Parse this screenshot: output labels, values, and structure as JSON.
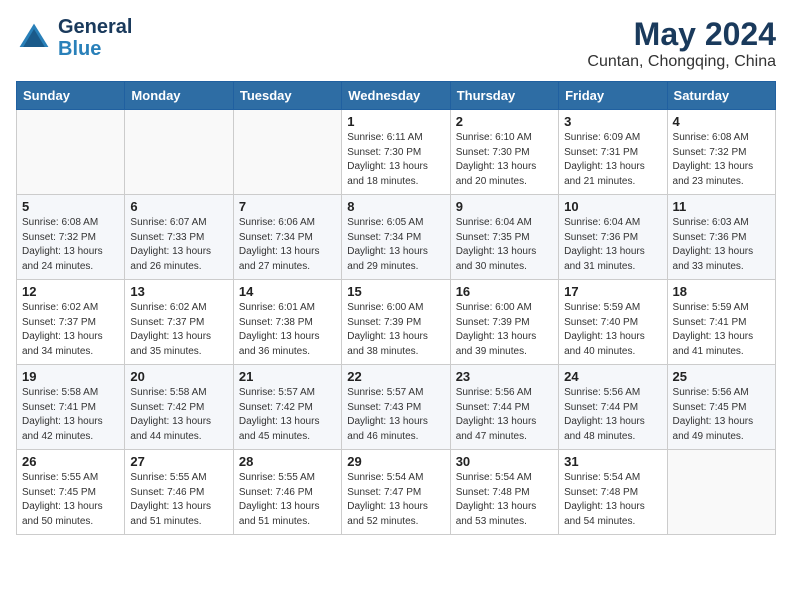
{
  "app": {
    "name": "GeneralBlue",
    "logo_line1": "General",
    "logo_line2": "Blue"
  },
  "title": "May 2024",
  "subtitle": "Cuntan, Chongqing, China",
  "weekdays": [
    "Sunday",
    "Monday",
    "Tuesday",
    "Wednesday",
    "Thursday",
    "Friday",
    "Saturday"
  ],
  "weeks": [
    [
      {
        "day": "",
        "info": ""
      },
      {
        "day": "",
        "info": ""
      },
      {
        "day": "",
        "info": ""
      },
      {
        "day": "1",
        "info": "Sunrise: 6:11 AM\nSunset: 7:30 PM\nDaylight: 13 hours\nand 18 minutes."
      },
      {
        "day": "2",
        "info": "Sunrise: 6:10 AM\nSunset: 7:30 PM\nDaylight: 13 hours\nand 20 minutes."
      },
      {
        "day": "3",
        "info": "Sunrise: 6:09 AM\nSunset: 7:31 PM\nDaylight: 13 hours\nand 21 minutes."
      },
      {
        "day": "4",
        "info": "Sunrise: 6:08 AM\nSunset: 7:32 PM\nDaylight: 13 hours\nand 23 minutes."
      }
    ],
    [
      {
        "day": "5",
        "info": "Sunrise: 6:08 AM\nSunset: 7:32 PM\nDaylight: 13 hours\nand 24 minutes."
      },
      {
        "day": "6",
        "info": "Sunrise: 6:07 AM\nSunset: 7:33 PM\nDaylight: 13 hours\nand 26 minutes."
      },
      {
        "day": "7",
        "info": "Sunrise: 6:06 AM\nSunset: 7:34 PM\nDaylight: 13 hours\nand 27 minutes."
      },
      {
        "day": "8",
        "info": "Sunrise: 6:05 AM\nSunset: 7:34 PM\nDaylight: 13 hours\nand 29 minutes."
      },
      {
        "day": "9",
        "info": "Sunrise: 6:04 AM\nSunset: 7:35 PM\nDaylight: 13 hours\nand 30 minutes."
      },
      {
        "day": "10",
        "info": "Sunrise: 6:04 AM\nSunset: 7:36 PM\nDaylight: 13 hours\nand 31 minutes."
      },
      {
        "day": "11",
        "info": "Sunrise: 6:03 AM\nSunset: 7:36 PM\nDaylight: 13 hours\nand 33 minutes."
      }
    ],
    [
      {
        "day": "12",
        "info": "Sunrise: 6:02 AM\nSunset: 7:37 PM\nDaylight: 13 hours\nand 34 minutes."
      },
      {
        "day": "13",
        "info": "Sunrise: 6:02 AM\nSunset: 7:37 PM\nDaylight: 13 hours\nand 35 minutes."
      },
      {
        "day": "14",
        "info": "Sunrise: 6:01 AM\nSunset: 7:38 PM\nDaylight: 13 hours\nand 36 minutes."
      },
      {
        "day": "15",
        "info": "Sunrise: 6:00 AM\nSunset: 7:39 PM\nDaylight: 13 hours\nand 38 minutes."
      },
      {
        "day": "16",
        "info": "Sunrise: 6:00 AM\nSunset: 7:39 PM\nDaylight: 13 hours\nand 39 minutes."
      },
      {
        "day": "17",
        "info": "Sunrise: 5:59 AM\nSunset: 7:40 PM\nDaylight: 13 hours\nand 40 minutes."
      },
      {
        "day": "18",
        "info": "Sunrise: 5:59 AM\nSunset: 7:41 PM\nDaylight: 13 hours\nand 41 minutes."
      }
    ],
    [
      {
        "day": "19",
        "info": "Sunrise: 5:58 AM\nSunset: 7:41 PM\nDaylight: 13 hours\nand 42 minutes."
      },
      {
        "day": "20",
        "info": "Sunrise: 5:58 AM\nSunset: 7:42 PM\nDaylight: 13 hours\nand 44 minutes."
      },
      {
        "day": "21",
        "info": "Sunrise: 5:57 AM\nSunset: 7:42 PM\nDaylight: 13 hours\nand 45 minutes."
      },
      {
        "day": "22",
        "info": "Sunrise: 5:57 AM\nSunset: 7:43 PM\nDaylight: 13 hours\nand 46 minutes."
      },
      {
        "day": "23",
        "info": "Sunrise: 5:56 AM\nSunset: 7:44 PM\nDaylight: 13 hours\nand 47 minutes."
      },
      {
        "day": "24",
        "info": "Sunrise: 5:56 AM\nSunset: 7:44 PM\nDaylight: 13 hours\nand 48 minutes."
      },
      {
        "day": "25",
        "info": "Sunrise: 5:56 AM\nSunset: 7:45 PM\nDaylight: 13 hours\nand 49 minutes."
      }
    ],
    [
      {
        "day": "26",
        "info": "Sunrise: 5:55 AM\nSunset: 7:45 PM\nDaylight: 13 hours\nand 50 minutes."
      },
      {
        "day": "27",
        "info": "Sunrise: 5:55 AM\nSunset: 7:46 PM\nDaylight: 13 hours\nand 51 minutes."
      },
      {
        "day": "28",
        "info": "Sunrise: 5:55 AM\nSunset: 7:46 PM\nDaylight: 13 hours\nand 51 minutes."
      },
      {
        "day": "29",
        "info": "Sunrise: 5:54 AM\nSunset: 7:47 PM\nDaylight: 13 hours\nand 52 minutes."
      },
      {
        "day": "30",
        "info": "Sunrise: 5:54 AM\nSunset: 7:48 PM\nDaylight: 13 hours\nand 53 minutes."
      },
      {
        "day": "31",
        "info": "Sunrise: 5:54 AM\nSunset: 7:48 PM\nDaylight: 13 hours\nand 54 minutes."
      },
      {
        "day": "",
        "info": ""
      }
    ]
  ]
}
